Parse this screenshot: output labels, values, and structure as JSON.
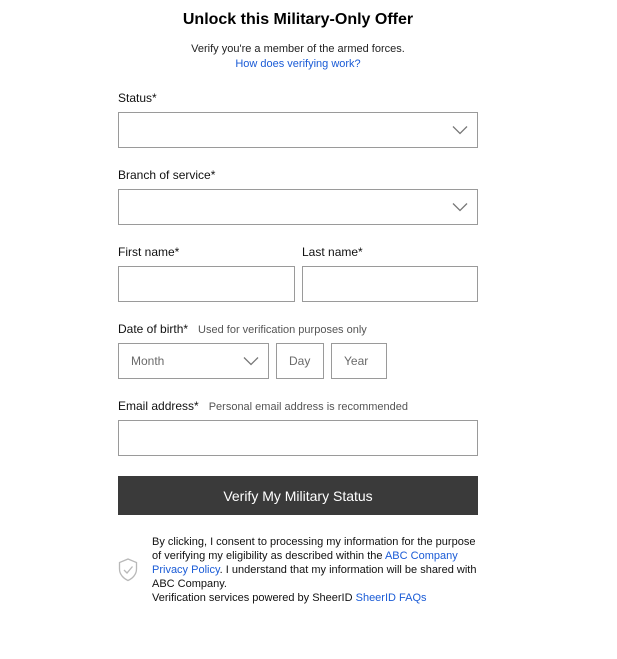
{
  "header": {
    "title": "Unlock this Military-Only Offer",
    "subtitle": "Verify you're a member of the armed forces.",
    "how_link": "How does verifying work?"
  },
  "form": {
    "status": {
      "label": "Status*",
      "value": ""
    },
    "branch": {
      "label": "Branch of service*",
      "value": ""
    },
    "first_name": {
      "label": "First name*",
      "value": ""
    },
    "last_name": {
      "label": "Last name*",
      "value": ""
    },
    "dob": {
      "label": "Date of birth*",
      "hint": "Used for verification purposes only",
      "month_placeholder": "Month",
      "day_placeholder": "Day",
      "year_placeholder": "Year"
    },
    "email": {
      "label": "Email address*",
      "hint": "Personal email address is recommended",
      "value": ""
    },
    "submit_label": "Verify My Military Status"
  },
  "consent": {
    "text_1": "By clicking, I consent to processing my information for the purpose of verifying my eligibility as described within the ",
    "privacy_link": "ABC Company Privacy Policy",
    "text_2": ". I understand that my information will be shared with ABC Company.",
    "powered_by": "Verification services powered by SheerID ",
    "faq_link": "SheerID FAQs"
  },
  "icons": {
    "chevron": "chevron-down-icon",
    "shield": "shield-check-icon"
  },
  "colors": {
    "link": "#1a5bd6",
    "button_bg": "#3a3a3a",
    "border": "#9a9a9a"
  }
}
